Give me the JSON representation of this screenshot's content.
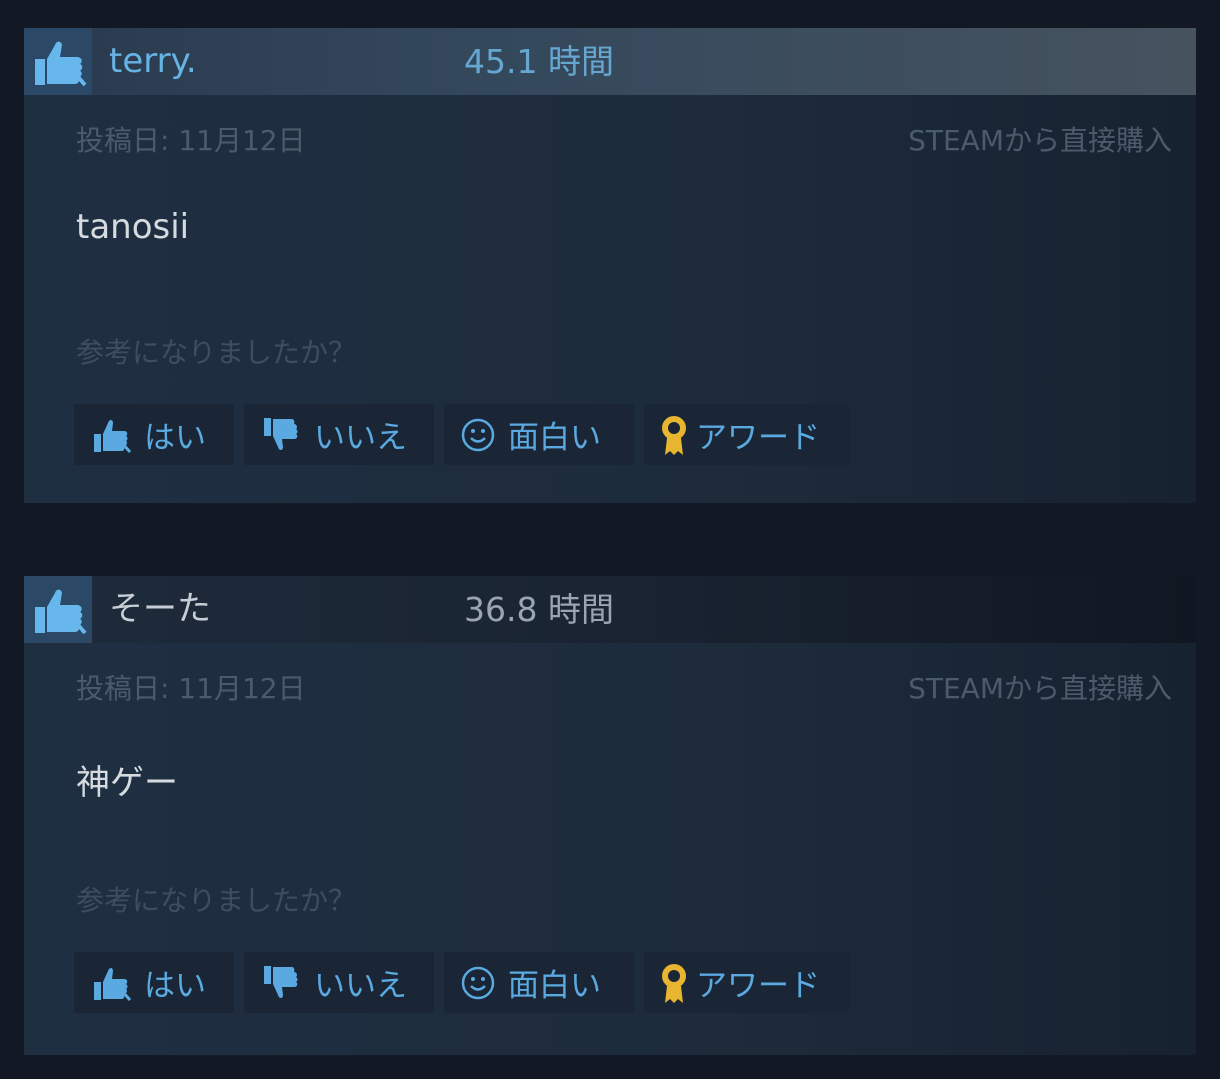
{
  "reviews": [
    {
      "author": "terry.",
      "hours": "45.1 時間",
      "posted": "投稿日: 11月12日",
      "purchase": "STEAMから直接購入",
      "content": "tanosii",
      "helpful_prompt": "参考になりましたか？",
      "buttons": {
        "yes": "はい",
        "no": "いいえ",
        "funny": "面白い",
        "award": "アワード"
      }
    },
    {
      "author": "そーた",
      "hours": "36.8 時間",
      "posted": "投稿日: 11月12日",
      "purchase": "STEAMから直接購入",
      "content": "神ゲー",
      "helpful_prompt": "参考になりましたか？",
      "buttons": {
        "yes": "はい",
        "no": "いいえ",
        "funny": "面白い",
        "award": "アワード"
      }
    }
  ],
  "icons": {
    "recommended": "thumbs-up-icon",
    "yes": "thumbs-up-icon",
    "no": "thumbs-down-icon",
    "funny": "smiley-icon",
    "award": "award-ribbon-icon"
  },
  "colors": {
    "background": "#121925",
    "link_blue": "#66b3e5",
    "award_gold": "#e8b530",
    "muted_text": "#4c5b6b"
  }
}
